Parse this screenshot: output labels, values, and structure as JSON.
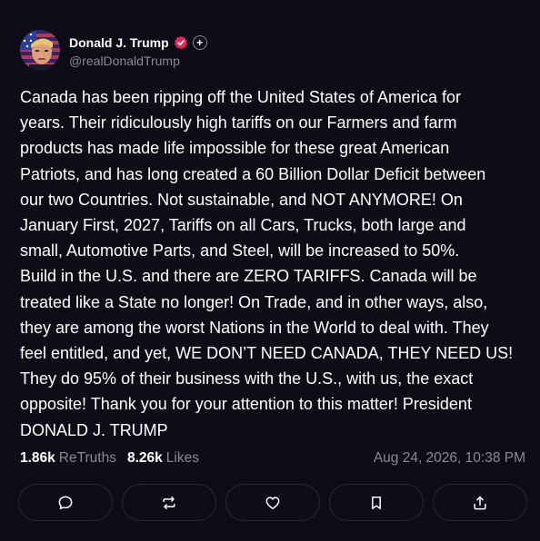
{
  "author": {
    "display_name": "Donald J. Trump",
    "handle": "@realDonaldTrump",
    "verified_icon": "verified-check-icon",
    "plus_badge": "+"
  },
  "post": {
    "text": "Canada has been ripping off the United States of America for\nyears. Their ridiculously high tariffs on our Farmers and farm\nproducts has made life impossible for these great American\nPatriots, and has long created a 60 Billion Dollar Deficit between\nour two Countries. Not sustainable, and NOT ANYMORE! On\nJanuary First, 2027, Tariffs on all Cars, Trucks, both large and\nsmall, Automotive Parts, and Steel, will be increased to 50%.\nBuild in the U.S. and there are ZERO TARIFFS. Canada will be\ntreated like a State no longer! On Trade, and in other ways, also,\nthey are among the worst Nations in the World to deal with. They\nfeel entitled, and yet, WE DON’T NEED CANADA, THEY NEED US!\nThey do 95% of their business with the U.S., with us, the exact\nopposite! Thank you for your attention to this matter! President\nDONALD J. TRUMP"
  },
  "stats": {
    "retruths_count": "1.86k",
    "retruths_label": "ReTruths",
    "likes_count": "8.26k",
    "likes_label": "Likes",
    "timestamp": "Aug 24, 2026, 10:38 PM"
  },
  "actions": [
    {
      "name": "reply",
      "icon": "comment-icon"
    },
    {
      "name": "retruth",
      "icon": "repost-icon"
    },
    {
      "name": "like",
      "icon": "heart-icon"
    },
    {
      "name": "bookmark",
      "icon": "bookmark-icon"
    },
    {
      "name": "share",
      "icon": "share-icon"
    }
  ],
  "colors": {
    "background": "#0e0d17",
    "text": "#ffffff",
    "muted": "#8b8898",
    "verified": "#e8255b",
    "button_border": "#2a2838"
  }
}
